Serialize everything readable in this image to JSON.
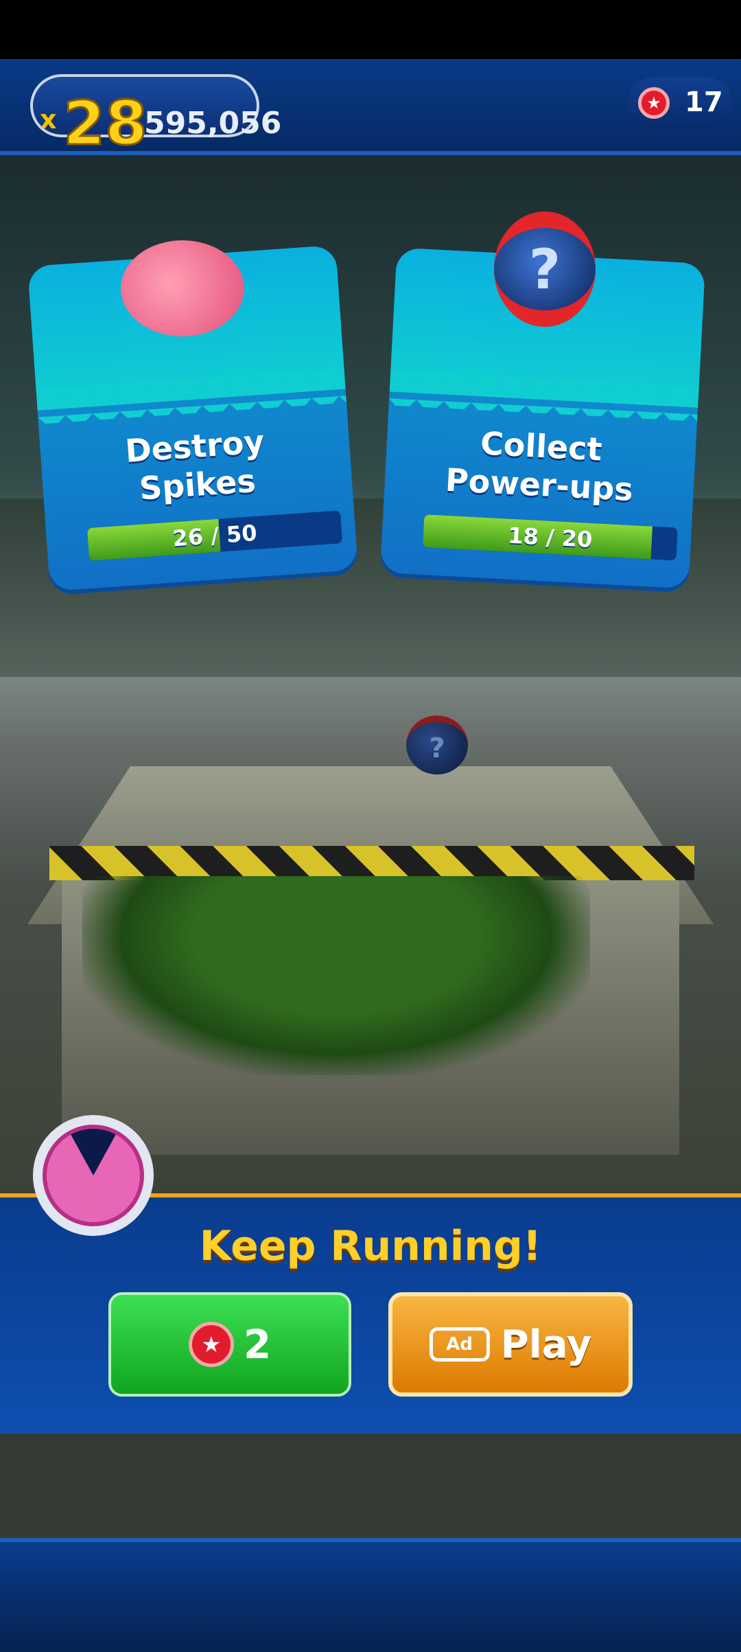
{
  "hud": {
    "multiplier_prefix": "x",
    "multiplier": "28",
    "score": "595,056",
    "red_star_rings": "17"
  },
  "missions": [
    {
      "title_line1": "Destroy",
      "title_line2": "Spikes",
      "current": "26",
      "separator": "/",
      "target": "50",
      "progress": 0.52
    },
    {
      "title_line1": "Collect",
      "title_line2": "Power-ups",
      "current": "18",
      "separator": "/",
      "target": "20",
      "progress": 0.9
    }
  ],
  "continue_panel": {
    "heading": "Keep Running!",
    "ring_cost": "2",
    "ad_label": "Ad",
    "play_label": "Play"
  },
  "colors": {
    "gold_text": "#ffcf2a",
    "panel_blue": "#0a3c8e",
    "green_button": "#11a51f",
    "orange_button": "#dd7a00",
    "ring_red": "#e21c2c",
    "timer_pink": "#e866b6"
  },
  "icons": {
    "ring": "red-star-ring-icon",
    "timer": "stopwatch-icon",
    "ad": "video-ad-icon",
    "powerup": "mystery-powerup-icon",
    "enemy": "spikes-badnik-icon"
  }
}
